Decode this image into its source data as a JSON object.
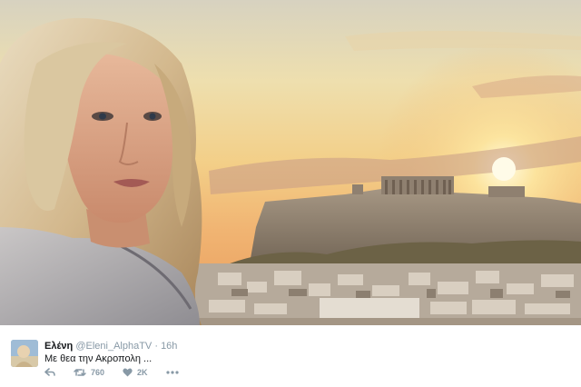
{
  "photo": {
    "description_icon": "sunset-acropolis-photo"
  },
  "tweet": {
    "display_name": "Ελένη",
    "handle": "@Eleni_AlphaTV",
    "separator": "·",
    "time": "16h",
    "text": "Με θεα την Ακροπολη ...",
    "actions": {
      "reply_icon": "reply-icon",
      "retweet_icon": "retweet-icon",
      "retweet_count": "760",
      "like_icon": "heart-icon",
      "like_count": "2K",
      "more_icon": "more-dots-icon"
    }
  },
  "colors": {
    "muted": "#8899a6",
    "text": "#14171a",
    "sky_top": "#e9dcae",
    "sun": "#fff6c8"
  }
}
